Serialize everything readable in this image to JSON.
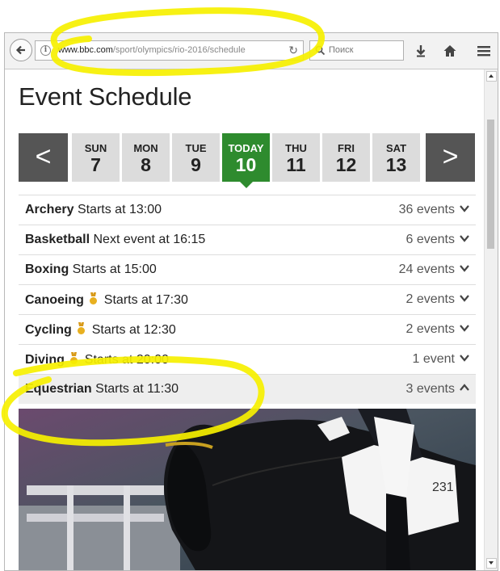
{
  "browser": {
    "url_host": "www.bbc.com",
    "url_path": "/sport/olympics/rio-2016/schedule",
    "search_placeholder": "Поиск"
  },
  "page": {
    "title": "Event Schedule"
  },
  "days": [
    {
      "name": "SUN",
      "num": "7"
    },
    {
      "name": "MON",
      "num": "8"
    },
    {
      "name": "TUE",
      "num": "9"
    },
    {
      "name": "TODAY",
      "num": "10"
    },
    {
      "name": "THU",
      "num": "11"
    },
    {
      "name": "FRI",
      "num": "12"
    },
    {
      "name": "SAT",
      "num": "13"
    }
  ],
  "nav": {
    "prev": "<",
    "next": ">"
  },
  "events": [
    {
      "sport": "Archery",
      "detail": "Starts at 13:00",
      "count": "36 events",
      "medal": false
    },
    {
      "sport": "Basketball",
      "detail": "Next event at 16:15",
      "count": "6 events",
      "medal": false
    },
    {
      "sport": "Boxing",
      "detail": "Starts at 15:00",
      "count": "24 events",
      "medal": false
    },
    {
      "sport": "Canoeing",
      "detail": "Starts at 17:30",
      "count": "2 events",
      "medal": true
    },
    {
      "sport": "Cycling",
      "detail": "Starts at 12:30",
      "count": "2 events",
      "medal": true
    },
    {
      "sport": "Diving",
      "detail": "Starts at 20:00",
      "count": "1 event",
      "medal": true
    },
    {
      "sport": "Equestrian",
      "detail": "Starts at 11:30",
      "count": "3 events",
      "medal": false,
      "expanded": true
    }
  ],
  "colors": {
    "today": "#2e8b2e",
    "nav_arrow_bg": "#555555",
    "day_bg": "#dcdcdc",
    "medal": "#e8b020",
    "annotation": "#ffff00"
  }
}
